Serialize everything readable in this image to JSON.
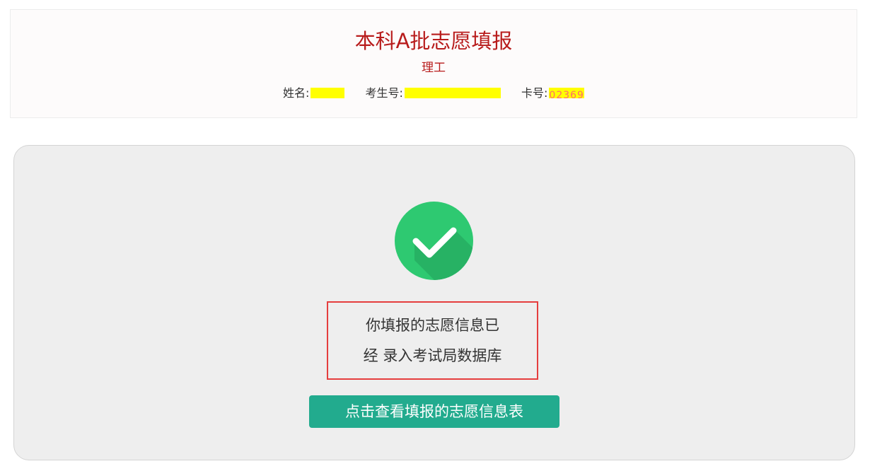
{
  "header": {
    "title": "本科A批志愿填报",
    "subtitle": "理工",
    "name_label": "姓名:",
    "exam_number_label": "考生号:",
    "card_number_label": "卡号:",
    "card_number_partial": "02369"
  },
  "result": {
    "icon": "check-circle-icon",
    "message_line1": "你填报的志愿信息已",
    "message_line2": "经 录入考试局数据库",
    "view_button": "点击查看填报的志愿信息表"
  },
  "colors": {
    "title": "#b81c1c",
    "success_green": "#2ec971",
    "button_teal": "#22ab8e",
    "highlight_border": "#e53e3e",
    "redaction": "#ffff00"
  }
}
